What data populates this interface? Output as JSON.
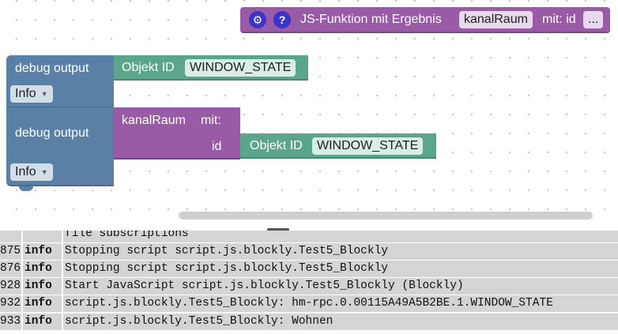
{
  "workspace": {
    "function_block": {
      "title": "JS-Funktion mit Ergebnis",
      "name": "kanalRaum",
      "params_label": "mit: id",
      "more": "...",
      "settings_icon": "gear-icon",
      "help_icon": "?"
    },
    "debug_block_1": {
      "label": "debug output",
      "level": "Info",
      "object": {
        "label": "Objekt ID",
        "value": "WINDOW_STATE"
      }
    },
    "debug_block_2": {
      "label": "debug output",
      "level": "Info",
      "call": {
        "name": "kanalRaum",
        "with_label": "mit:",
        "param_label": "id",
        "object": {
          "label": "Objekt ID",
          "value": "WINDOW_STATE"
        }
      }
    }
  },
  "log": {
    "partial_row": "file subscriptions",
    "rows": [
      {
        "num": "875",
        "level": "info",
        "message": "Stopping script script.js.blockly.Test5_Blockly"
      },
      {
        "num": "876",
        "level": "info",
        "message": "Stopping script script.js.blockly.Test5_Blockly"
      },
      {
        "num": "928",
        "level": "info",
        "message": "Start JavaScript script.js.blockly.Test5_Blockly (Blockly)"
      },
      {
        "num": "932",
        "level": "info",
        "message": "script.js.blockly.Test5_Blockly: hm-rpc.0.00115A49A5B2BE.1.WINDOW_STATE"
      },
      {
        "num": "933",
        "level": "info",
        "message": "script.js.blockly.Test5_Blockly: Wohnen"
      }
    ]
  },
  "colors": {
    "blue_block": "#5b80a5",
    "green_block": "#5ba58c",
    "purple_block": "#995ba5"
  }
}
